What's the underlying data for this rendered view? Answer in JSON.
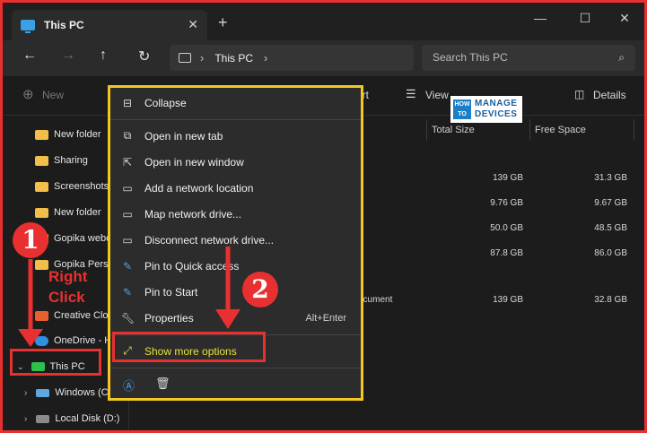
{
  "window": {
    "tab_title": "This PC",
    "tab_close": "✕",
    "new_tab": "+",
    "minimize": "—",
    "maximize": "☐",
    "close": "✕"
  },
  "nav": {
    "back": "←",
    "forward": "→",
    "up": "↑",
    "refresh": "↻",
    "breadcrumb": [
      "This PC"
    ],
    "chevron": "›",
    "search_placeholder": "Search This PC",
    "search_icon": "⌕"
  },
  "command_bar": {
    "new_label": "New",
    "sort_label": "ort",
    "view_label": "View",
    "details_label": "Details"
  },
  "sidebar": {
    "items": [
      {
        "label": "New folder",
        "icon": "folder-icon"
      },
      {
        "label": "Sharing",
        "icon": "folder-icon"
      },
      {
        "label": "Screenshots",
        "icon": "folder-icon"
      },
      {
        "label": "New folder",
        "icon": "folder-icon"
      },
      {
        "label": "Gopika webo",
        "icon": "folder-icon"
      },
      {
        "label": "Gopika Perso",
        "icon": "folder-icon"
      },
      {
        "label": "Creative Clou",
        "icon": "creative-cloud-icon"
      },
      {
        "label": "OneDrive - H",
        "icon": "onedrive-icon"
      },
      {
        "label": "This PC",
        "icon": "pc-icon"
      },
      {
        "label": "Windows (C",
        "icon": "drive-icon"
      },
      {
        "label": "Local Disk (D:)",
        "icon": "drive-icon"
      }
    ]
  },
  "table": {
    "headers": [
      "Total Size",
      "Free Space"
    ],
    "rows": [
      {
        "total": "139 GB",
        "free": "31.3 GB"
      },
      {
        "total": "9.76 GB",
        "free": "9.67 GB"
      },
      {
        "total": "50.0 GB",
        "free": "48.5 GB"
      },
      {
        "total": "87.8 GB",
        "free": "86.0 GB"
      },
      {
        "type": "ocument",
        "total": "139 GB",
        "free": "32.8 GB"
      }
    ]
  },
  "context_menu": {
    "items": [
      {
        "label": "Collapse",
        "icon": "collapse-icon"
      },
      {
        "label": "Open in new tab",
        "icon": "new-tab-icon"
      },
      {
        "label": "Open in new window",
        "icon": "new-window-icon"
      },
      {
        "label": "Add a network location",
        "icon": "network-location-icon"
      },
      {
        "label": "Map network drive...",
        "icon": "map-drive-icon"
      },
      {
        "label": "Disconnect network drive...",
        "icon": "disconnect-drive-icon"
      },
      {
        "label": "Pin to Quick access",
        "icon": "pin-icon"
      },
      {
        "label": "Pin to Start",
        "icon": "pin-icon"
      },
      {
        "label": "Properties",
        "icon": "wrench-icon",
        "shortcut": "Alt+Enter"
      },
      {
        "label": "Show more options",
        "icon": "more-options-icon"
      }
    ]
  },
  "annotations": {
    "step1": "1",
    "step2": "2",
    "right": "Right",
    "click": "Click"
  },
  "logo": {
    "how": "HOW TO",
    "line1": "MANAGE",
    "line2": "DEVICES"
  },
  "colors": {
    "annotation_red": "#e83030",
    "menu_border_yellow": "#f3c623",
    "show_more_text": "#e8e23a"
  }
}
